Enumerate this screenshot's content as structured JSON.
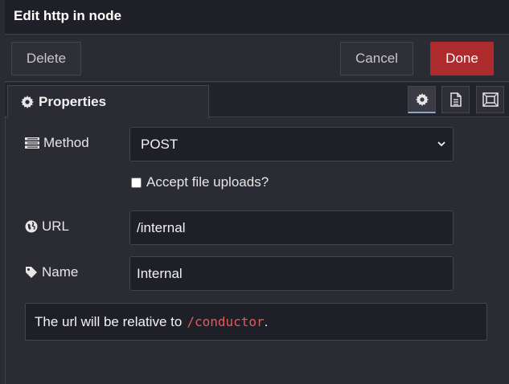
{
  "dialog": {
    "title": "Edit http in node"
  },
  "toolbar": {
    "delete_label": "Delete",
    "cancel_label": "Cancel",
    "done_label": "Done"
  },
  "tabs": {
    "properties_label": "Properties",
    "icon_tabs": [
      "gear-icon",
      "document-icon",
      "frame-icon"
    ]
  },
  "form": {
    "method_label": "Method",
    "method_value": "POST",
    "accept_uploads_label": "Accept file uploads?",
    "accept_uploads_checked": false,
    "url_label": "URL",
    "url_value": "/internal",
    "name_label": "Name",
    "name_value": "Internal"
  },
  "tip": {
    "prefix": "The url will be relative to",
    "path": "/conductor",
    "suffix": "."
  },
  "colors": {
    "background": "#2a2b33",
    "done_button": "#ad2a2d",
    "code_text": "#e05a5a"
  }
}
